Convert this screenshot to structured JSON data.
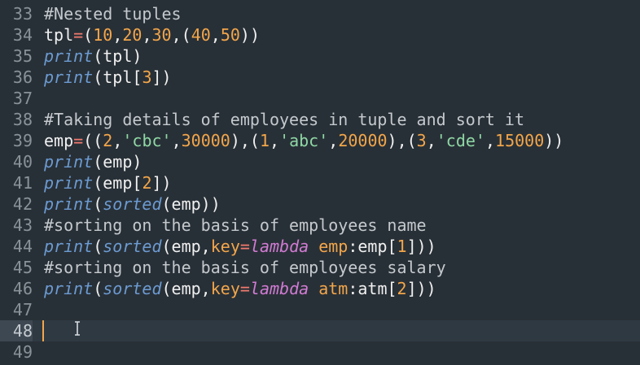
{
  "lines": [
    {
      "n": "33",
      "tokens": [
        {
          "t": "#Nested tuples",
          "k": "comment"
        }
      ]
    },
    {
      "n": "34",
      "tokens": [
        {
          "t": "tpl",
          "k": "plain"
        },
        {
          "t": "=",
          "k": "op"
        },
        {
          "t": "(",
          "k": "plain"
        },
        {
          "t": "10",
          "k": "num"
        },
        {
          "t": ",",
          "k": "plain"
        },
        {
          "t": "20",
          "k": "num"
        },
        {
          "t": ",",
          "k": "plain"
        },
        {
          "t": "30",
          "k": "num"
        },
        {
          "t": ",(",
          "k": "plain"
        },
        {
          "t": "40",
          "k": "num"
        },
        {
          "t": ",",
          "k": "plain"
        },
        {
          "t": "50",
          "k": "num"
        },
        {
          "t": "))",
          "k": "plain"
        }
      ]
    },
    {
      "n": "35",
      "tokens": [
        {
          "t": "print",
          "k": "fn"
        },
        {
          "t": "(tpl)",
          "k": "plain"
        }
      ]
    },
    {
      "n": "36",
      "tokens": [
        {
          "t": "print",
          "k": "fn"
        },
        {
          "t": "(tpl[",
          "k": "plain"
        },
        {
          "t": "3",
          "k": "num"
        },
        {
          "t": "])",
          "k": "plain"
        }
      ]
    },
    {
      "n": "37",
      "tokens": []
    },
    {
      "n": "38",
      "tokens": [
        {
          "t": "#Taking details of employees in tuple and sort it",
          "k": "comment"
        }
      ]
    },
    {
      "n": "39",
      "tokens": [
        {
          "t": "emp",
          "k": "plain"
        },
        {
          "t": "=",
          "k": "op"
        },
        {
          "t": "((",
          "k": "plain"
        },
        {
          "t": "2",
          "k": "num"
        },
        {
          "t": ",",
          "k": "plain"
        },
        {
          "t": "'cbc'",
          "k": "str"
        },
        {
          "t": ",",
          "k": "plain"
        },
        {
          "t": "30000",
          "k": "num"
        },
        {
          "t": "),(",
          "k": "plain"
        },
        {
          "t": "1",
          "k": "num"
        },
        {
          "t": ",",
          "k": "plain"
        },
        {
          "t": "'abc'",
          "k": "str"
        },
        {
          "t": ",",
          "k": "plain"
        },
        {
          "t": "20000",
          "k": "num"
        },
        {
          "t": "),(",
          "k": "plain"
        },
        {
          "t": "3",
          "k": "num"
        },
        {
          "t": ",",
          "k": "plain"
        },
        {
          "t": "'cde'",
          "k": "str"
        },
        {
          "t": ",",
          "k": "plain"
        },
        {
          "t": "15000",
          "k": "num"
        },
        {
          "t": "))",
          "k": "plain"
        }
      ]
    },
    {
      "n": "40",
      "tokens": [
        {
          "t": "print",
          "k": "fn"
        },
        {
          "t": "(emp)",
          "k": "plain"
        }
      ]
    },
    {
      "n": "41",
      "tokens": [
        {
          "t": "print",
          "k": "fn"
        },
        {
          "t": "(emp[",
          "k": "plain"
        },
        {
          "t": "2",
          "k": "num"
        },
        {
          "t": "])",
          "k": "plain"
        }
      ]
    },
    {
      "n": "42",
      "tokens": [
        {
          "t": "print",
          "k": "fn"
        },
        {
          "t": "(",
          "k": "plain"
        },
        {
          "t": "sorted",
          "k": "fn"
        },
        {
          "t": "(emp))",
          "k": "plain"
        }
      ]
    },
    {
      "n": "43",
      "tokens": [
        {
          "t": "#sorting on the basis of employees name",
          "k": "comment"
        }
      ]
    },
    {
      "n": "44",
      "tokens": [
        {
          "t": "print",
          "k": "fn"
        },
        {
          "t": "(",
          "k": "plain"
        },
        {
          "t": "sorted",
          "k": "fn"
        },
        {
          "t": "(emp,",
          "k": "plain"
        },
        {
          "t": "key",
          "k": "param"
        },
        {
          "t": "=",
          "k": "op"
        },
        {
          "t": "lambda",
          "k": "kw"
        },
        {
          "t": " ",
          "k": "plain"
        },
        {
          "t": "emp",
          "k": "param"
        },
        {
          "t": ":emp[",
          "k": "plain"
        },
        {
          "t": "1",
          "k": "num"
        },
        {
          "t": "]))",
          "k": "plain"
        }
      ]
    },
    {
      "n": "45",
      "tokens": [
        {
          "t": "#sorting on the basis of employees salary",
          "k": "comment"
        }
      ]
    },
    {
      "n": "46",
      "tokens": [
        {
          "t": "print",
          "k": "fn"
        },
        {
          "t": "(",
          "k": "plain"
        },
        {
          "t": "sorted",
          "k": "fn"
        },
        {
          "t": "(emp,",
          "k": "plain"
        },
        {
          "t": "key",
          "k": "param"
        },
        {
          "t": "=",
          "k": "op"
        },
        {
          "t": "lambda",
          "k": "kw"
        },
        {
          "t": " ",
          "k": "plain"
        },
        {
          "t": "atm",
          "k": "param"
        },
        {
          "t": ":atm[",
          "k": "plain"
        },
        {
          "t": "2",
          "k": "num"
        },
        {
          "t": "]))",
          "k": "plain"
        }
      ]
    },
    {
      "n": "47",
      "tokens": []
    },
    {
      "n": "48",
      "tokens": [],
      "active": true
    },
    {
      "n": "49",
      "tokens": []
    }
  ],
  "colors": {
    "background": "#283037",
    "comment": "#c4c9cd",
    "operator": "#f27a6f",
    "number": "#f3a64a",
    "function": "#6c9bd2",
    "string": "#8fd8a5",
    "keyword": "#d17bd3",
    "caret": "#f3a64a"
  },
  "cursor_icon": "text-ibeam-icon"
}
